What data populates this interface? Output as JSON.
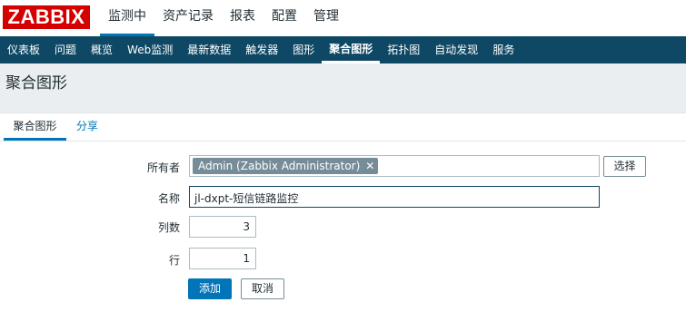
{
  "logo": "ZABBIX",
  "main_menu": [
    "监测中",
    "资产记录",
    "报表",
    "配置",
    "管理"
  ],
  "sub_menu": [
    "仪表板",
    "问题",
    "概览",
    "Web监测",
    "最新数据",
    "触发器",
    "图形",
    "聚合图形",
    "拓扑图",
    "自动发现",
    "服务"
  ],
  "page_title": "聚合图形",
  "tabs": [
    "聚合图形",
    "分享"
  ],
  "form": {
    "owner_label": "所有者",
    "owner_value": "Admin (Zabbix Administrator)",
    "owner_remove": "✕",
    "select_label": "选择",
    "name_label": "名称",
    "name_value": "jl-dxpt-短信链路监控",
    "columns_label": "列数",
    "columns_value": "3",
    "rows_label": "行",
    "rows_value": "1",
    "add_label": "添加",
    "cancel_label": "取消"
  }
}
